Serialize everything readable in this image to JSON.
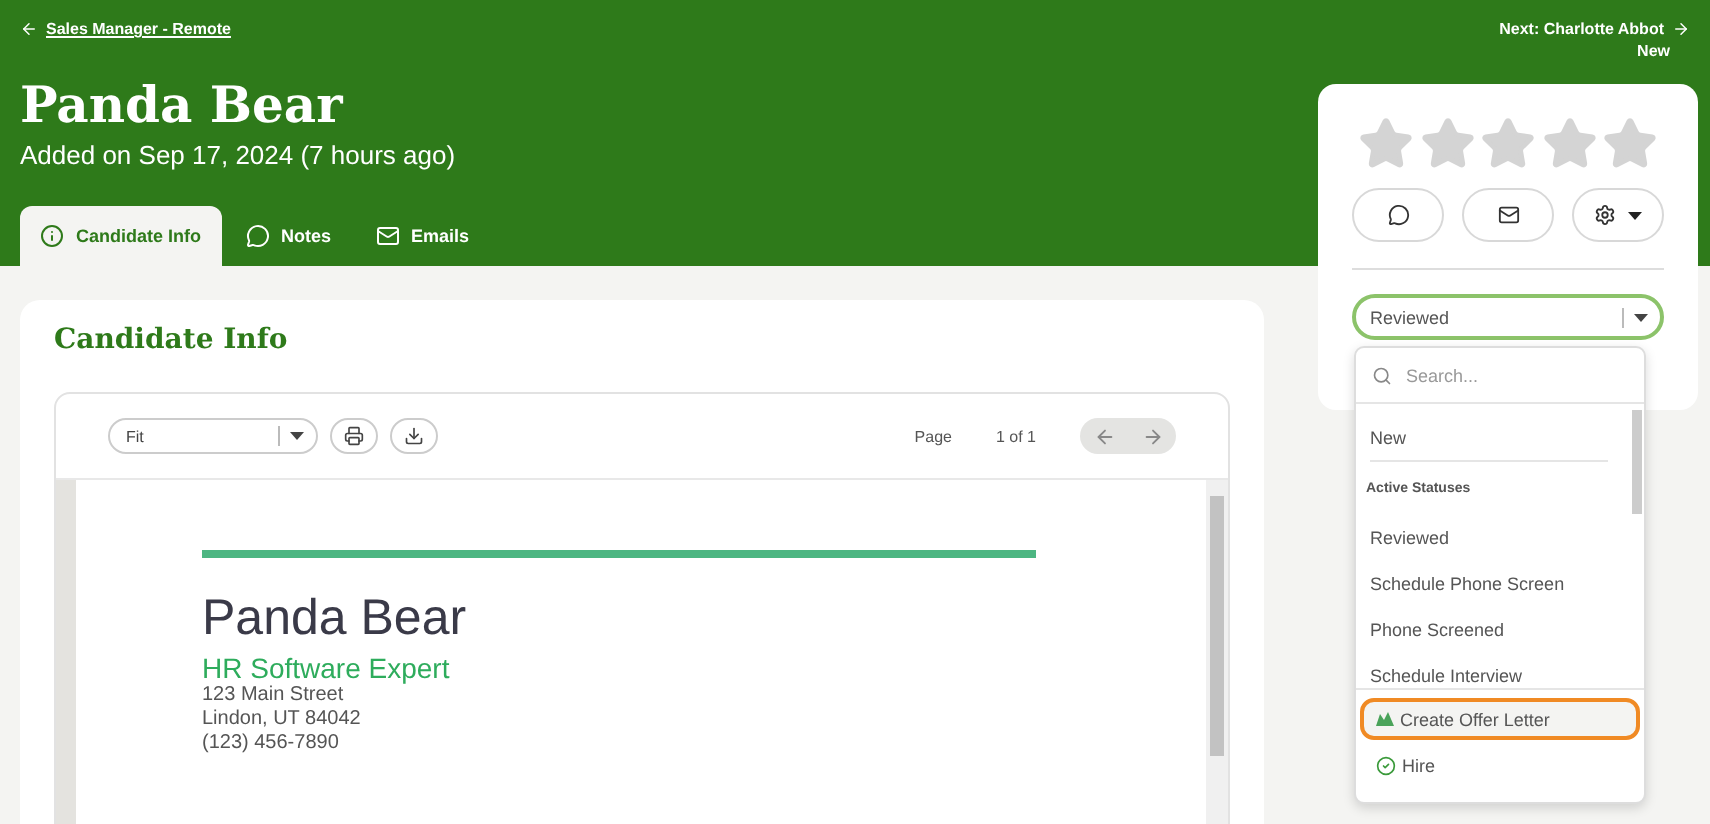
{
  "back_link": "Sales Manager - Remote",
  "next": {
    "label": "Next: Charlotte Abbot",
    "status": "New"
  },
  "candidate": {
    "name": "Panda Bear",
    "added": "Added on Sep 17, 2024 (7 hours ago)"
  },
  "tabs": [
    {
      "label": "Candidate Info",
      "selected": true
    },
    {
      "label": "Notes",
      "selected": false
    },
    {
      "label": "Emails",
      "selected": false
    }
  ],
  "section_title": "Candidate Info",
  "viewer": {
    "zoom": "Fit",
    "page_label": "Page",
    "page_count": "1 of 1"
  },
  "resume": {
    "name": "Panda Bear",
    "headline": "HR Software Expert",
    "contact_lines": [
      "123 Main Street",
      "Lindon, UT 84042",
      "(123) 456-7890"
    ]
  },
  "rating": {
    "stars": 0
  },
  "status_select": {
    "value": "Reviewed",
    "open": true
  },
  "status_menu": {
    "search_placeholder": "Search...",
    "items": [
      {
        "kind": "option",
        "label": "New"
      },
      {
        "kind": "header",
        "label": "Active Statuses"
      },
      {
        "kind": "option",
        "label": "Reviewed"
      },
      {
        "kind": "option",
        "label": "Schedule Phone Screen"
      },
      {
        "kind": "option",
        "label": "Phone Screened"
      },
      {
        "kind": "option",
        "label": "Schedule Interview"
      }
    ],
    "actions": [
      {
        "label": "Create Offer Letter",
        "highlighted": true
      },
      {
        "label": "Hire",
        "highlighted": false
      }
    ]
  }
}
